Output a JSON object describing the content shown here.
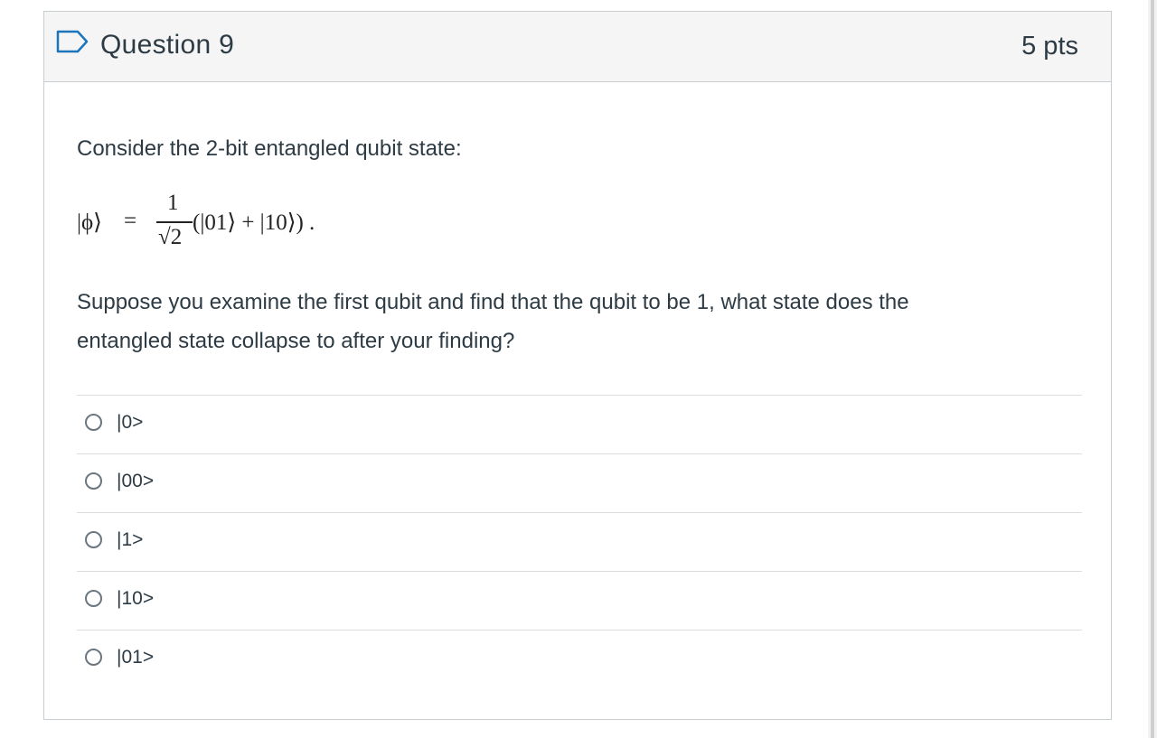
{
  "question": {
    "title": "Question 9",
    "points": "5 pts",
    "prompt": "Consider the 2-bit  entangled qubit state:",
    "equation": {
      "lhs": "|ϕ⟩",
      "equals": "=",
      "numerator": "1",
      "denominator": "√2",
      "rhs": "(|01⟩ + |10⟩) ."
    },
    "body_line1": "Suppose you examine the first qubit and find that the qubit to be 1, what state does the",
    "body_line2": "entangled state collapse to after your finding?"
  },
  "answers": [
    {
      "label": "|0>"
    },
    {
      "label": "|00>"
    },
    {
      "label": "|1>"
    },
    {
      "label": "|10>"
    },
    {
      "label": "|01>"
    }
  ],
  "icons": {
    "flag": "flag-outline-icon",
    "radio": "radio-unchecked-icon"
  },
  "colors": {
    "flag_accent": "#1b75bc",
    "text": "#2d3b45",
    "header_bg": "#f5f5f5",
    "border": "#c7cdd1"
  }
}
